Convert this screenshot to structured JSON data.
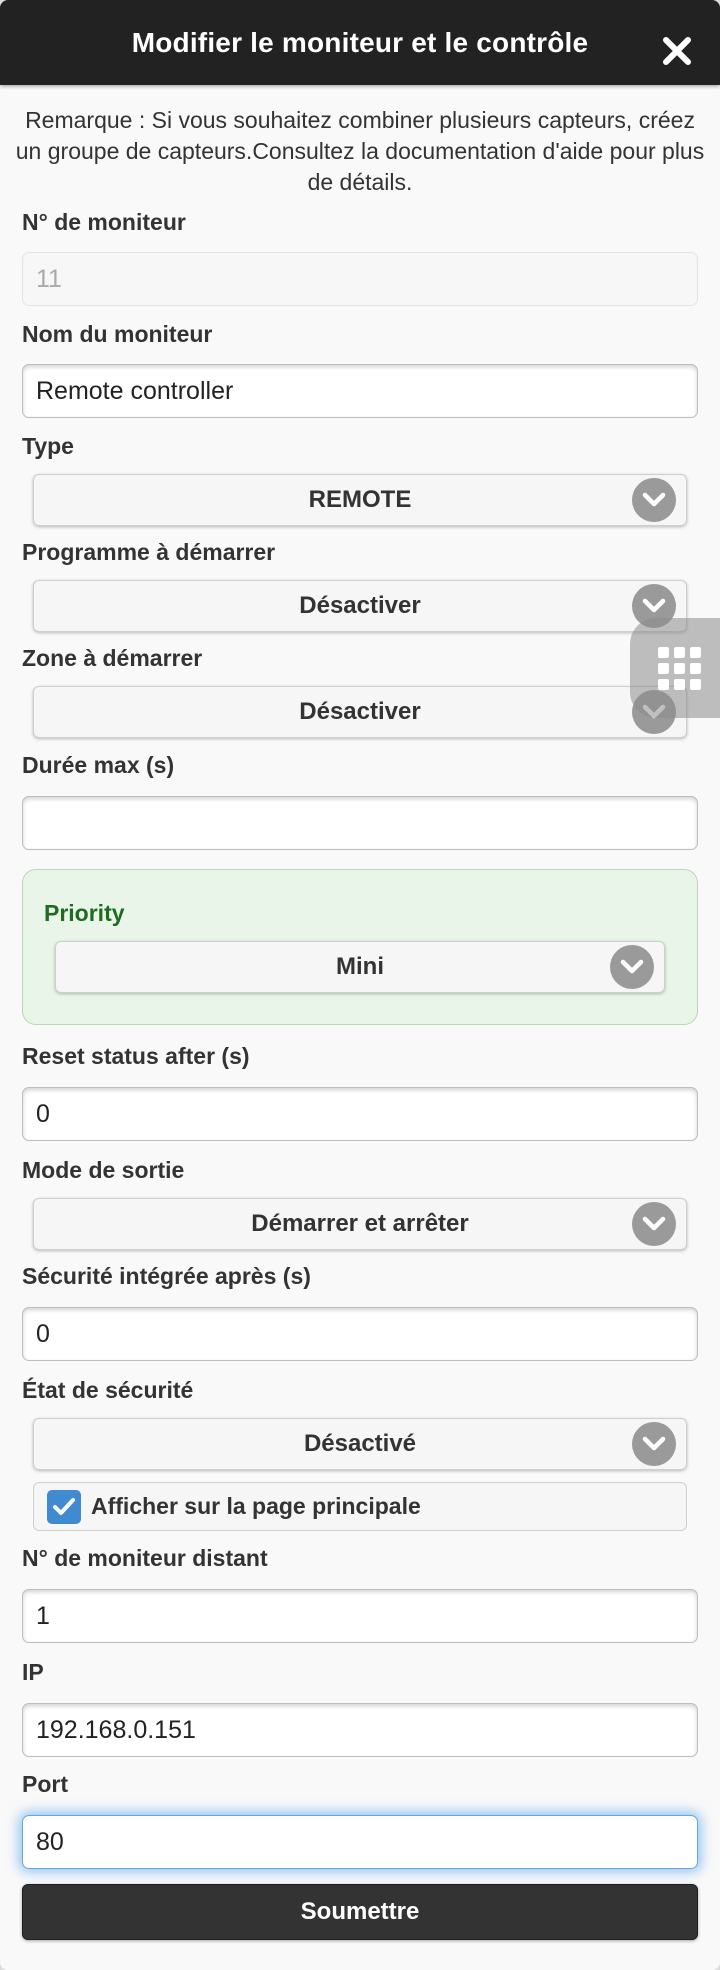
{
  "dialog": {
    "title": "Modifier le moniteur et le contrôle",
    "note": "Remarque : Si vous souhaitez combiner plusieurs capteurs, créez un groupe de capteurs.Consultez la documentation d'aide pour plus de détails."
  },
  "fields": {
    "monitor_no": {
      "label": "N° de moniteur",
      "value": "11"
    },
    "monitor_name": {
      "label": "Nom du moniteur",
      "value": "Remote controller"
    },
    "type": {
      "label": "Type",
      "selected": "REMOTE"
    },
    "program": {
      "label": "Programme à démarrer",
      "selected": "Désactiver"
    },
    "zone": {
      "label": "Zone à démarrer",
      "selected": "Désactiver"
    },
    "max_duration": {
      "label": "Durée max (s)",
      "value": ""
    },
    "priority": {
      "label": "Priority",
      "selected": "Mini"
    },
    "reset_status": {
      "label": "Reset status after (s)",
      "value": "0"
    },
    "output_mode": {
      "label": "Mode de sortie",
      "selected": "Démarrer et arrêter"
    },
    "failsafe_after": {
      "label": "Sécurité intégrée après (s)",
      "value": "0"
    },
    "failsafe_state": {
      "label": "État de sécurité",
      "selected": "Désactivé"
    },
    "show_main": {
      "label": "Afficher sur la page principale",
      "checked": true
    },
    "remote_monitor_no": {
      "label": "N° de moniteur distant",
      "value": "1"
    },
    "ip": {
      "label": "IP",
      "value": "192.168.0.151"
    },
    "port": {
      "label": "Port",
      "value": "80"
    }
  },
  "submit_label": "Soumettre",
  "icons": {
    "close": "close-icon",
    "chevron": "chevron-down-icon",
    "check": "checkmark-icon",
    "grid": "grid-menu-icon"
  },
  "colors": {
    "header_bg": "#222222",
    "priority_bg": "#e9f5e9",
    "priority_label": "#1e6b21",
    "checkbox": "#3f8ad1",
    "focus_glow": "#3898ec"
  }
}
